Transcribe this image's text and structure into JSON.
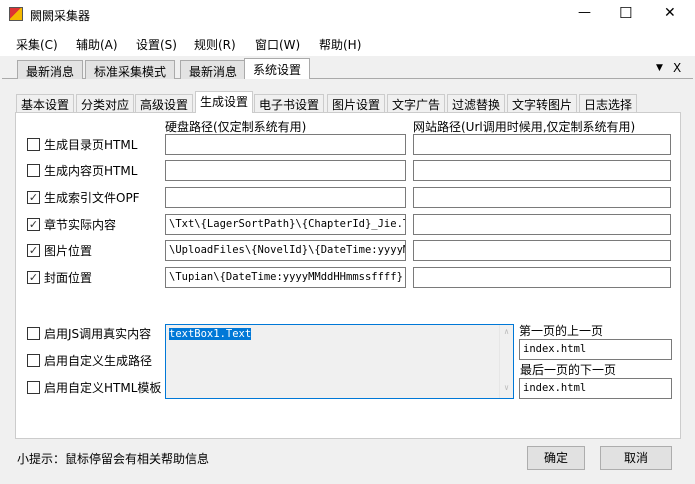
{
  "window": {
    "title": "闕闕采集器",
    "minimize": "—",
    "maximize": "☐",
    "close": "✕"
  },
  "menu": [
    "采集(C)",
    "辅助(A)",
    "设置(S)",
    "规则(R)",
    "窗口(W)",
    "帮助(H)"
  ],
  "outer_tabs": [
    "最新消息",
    "标准采集模式",
    "最新消息",
    "系统设置"
  ],
  "outer_controls": {
    "dropdown": "▼",
    "close": "X"
  },
  "inner_tabs": [
    "基本设置",
    "分类对应",
    "高级设置",
    "生成设置",
    "电子书设置",
    "图片设置",
    "文字广告",
    "过滤替换",
    "文字转图片",
    "日志选择"
  ],
  "headers": {
    "disk": "硬盘路径(仅定制系统有用)",
    "web": "网站路径(Url调用时候用,仅定制系统有用)"
  },
  "rows": [
    {
      "label": "生成目录页HTML",
      "checked": false,
      "disk": "",
      "web": ""
    },
    {
      "label": "生成内容页HTML",
      "checked": false,
      "disk": "",
      "web": ""
    },
    {
      "label": "生成索引文件OPF",
      "checked": true,
      "disk": "",
      "web": ""
    },
    {
      "label": "章节实际内容",
      "checked": true,
      "disk": "\\Txt\\{LagerSortPath}\\{ChapterId}_Jie.Txt",
      "web": ""
    },
    {
      "label": "图片位置",
      "checked": true,
      "disk": "\\UploadFiles\\{NovelId}\\{DateTime:yyyyMMddHHmmssffff}",
      "web": ""
    },
    {
      "label": "封面位置",
      "checked": true,
      "disk": "\\Tupian\\{DateTime:yyyyMMddHHmmssffff}.jpg",
      "web": ""
    }
  ],
  "options": [
    {
      "label": "启用JS调用真实内容",
      "checked": false
    },
    {
      "label": "启用自定义生成路径",
      "checked": false
    },
    {
      "label": "启用自定义HTML模板",
      "checked": false
    }
  ],
  "textarea": "textBox1.Text",
  "first_prev": {
    "label": "第一页的上一页",
    "value": "index.html"
  },
  "last_next": {
    "label": "最后一页的下一页",
    "value": "index.html"
  },
  "hint": "小提示：鼠标停留会有相关帮助信息",
  "ok": "确定",
  "cancel": "取消"
}
